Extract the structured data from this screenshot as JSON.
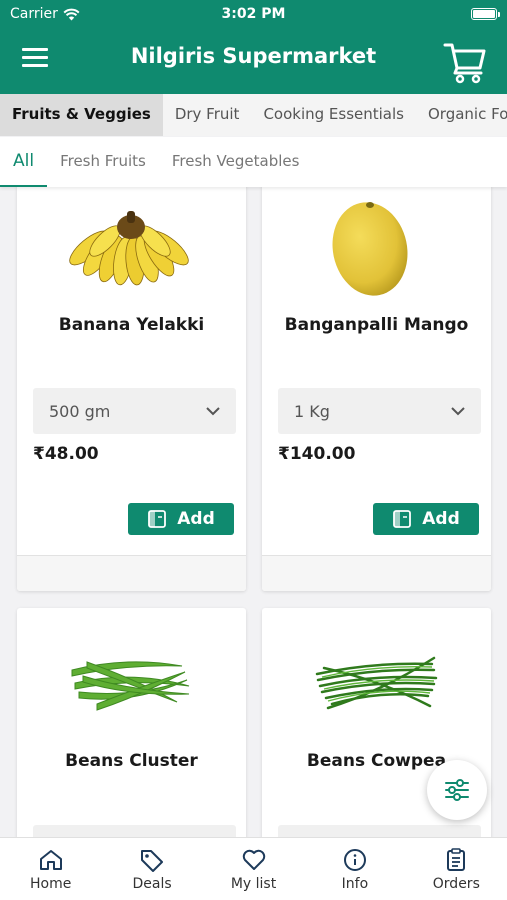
{
  "status_bar": {
    "carrier": "Carrier",
    "time": "3:02 PM"
  },
  "header": {
    "title": "Nilgiris Supermarket"
  },
  "category_tabs": [
    {
      "label": "Fruits & Veggies",
      "active": true
    },
    {
      "label": "Dry Fruit",
      "active": false
    },
    {
      "label": "Cooking Essentials",
      "active": false
    },
    {
      "label": "Organic Food",
      "active": false
    }
  ],
  "sub_tabs": [
    {
      "label": "All",
      "active": true
    },
    {
      "label": "Fresh Fruits",
      "active": false
    },
    {
      "label": "Fresh Vegetables",
      "active": false
    }
  ],
  "products": [
    {
      "name": "Banana Yelakki",
      "quantity": "500 gm",
      "price": "₹48.00",
      "add_label": "Add"
    },
    {
      "name": "Banganpalli Mango",
      "quantity": "1 Kg",
      "price": "₹140.00",
      "add_label": "Add"
    },
    {
      "name": "Beans Cluster"
    },
    {
      "name": "Beans Cowpea"
    }
  ],
  "bottom_nav": [
    {
      "label": "Home",
      "icon": "home-icon"
    },
    {
      "label": "Deals",
      "icon": "tag-icon"
    },
    {
      "label": "My list",
      "icon": "heart-icon"
    },
    {
      "label": "Info",
      "icon": "info-icon"
    },
    {
      "label": "Orders",
      "icon": "orders-icon"
    }
  ],
  "colors": {
    "brand": "#0f8a6f",
    "background": "#f2f2f4"
  }
}
